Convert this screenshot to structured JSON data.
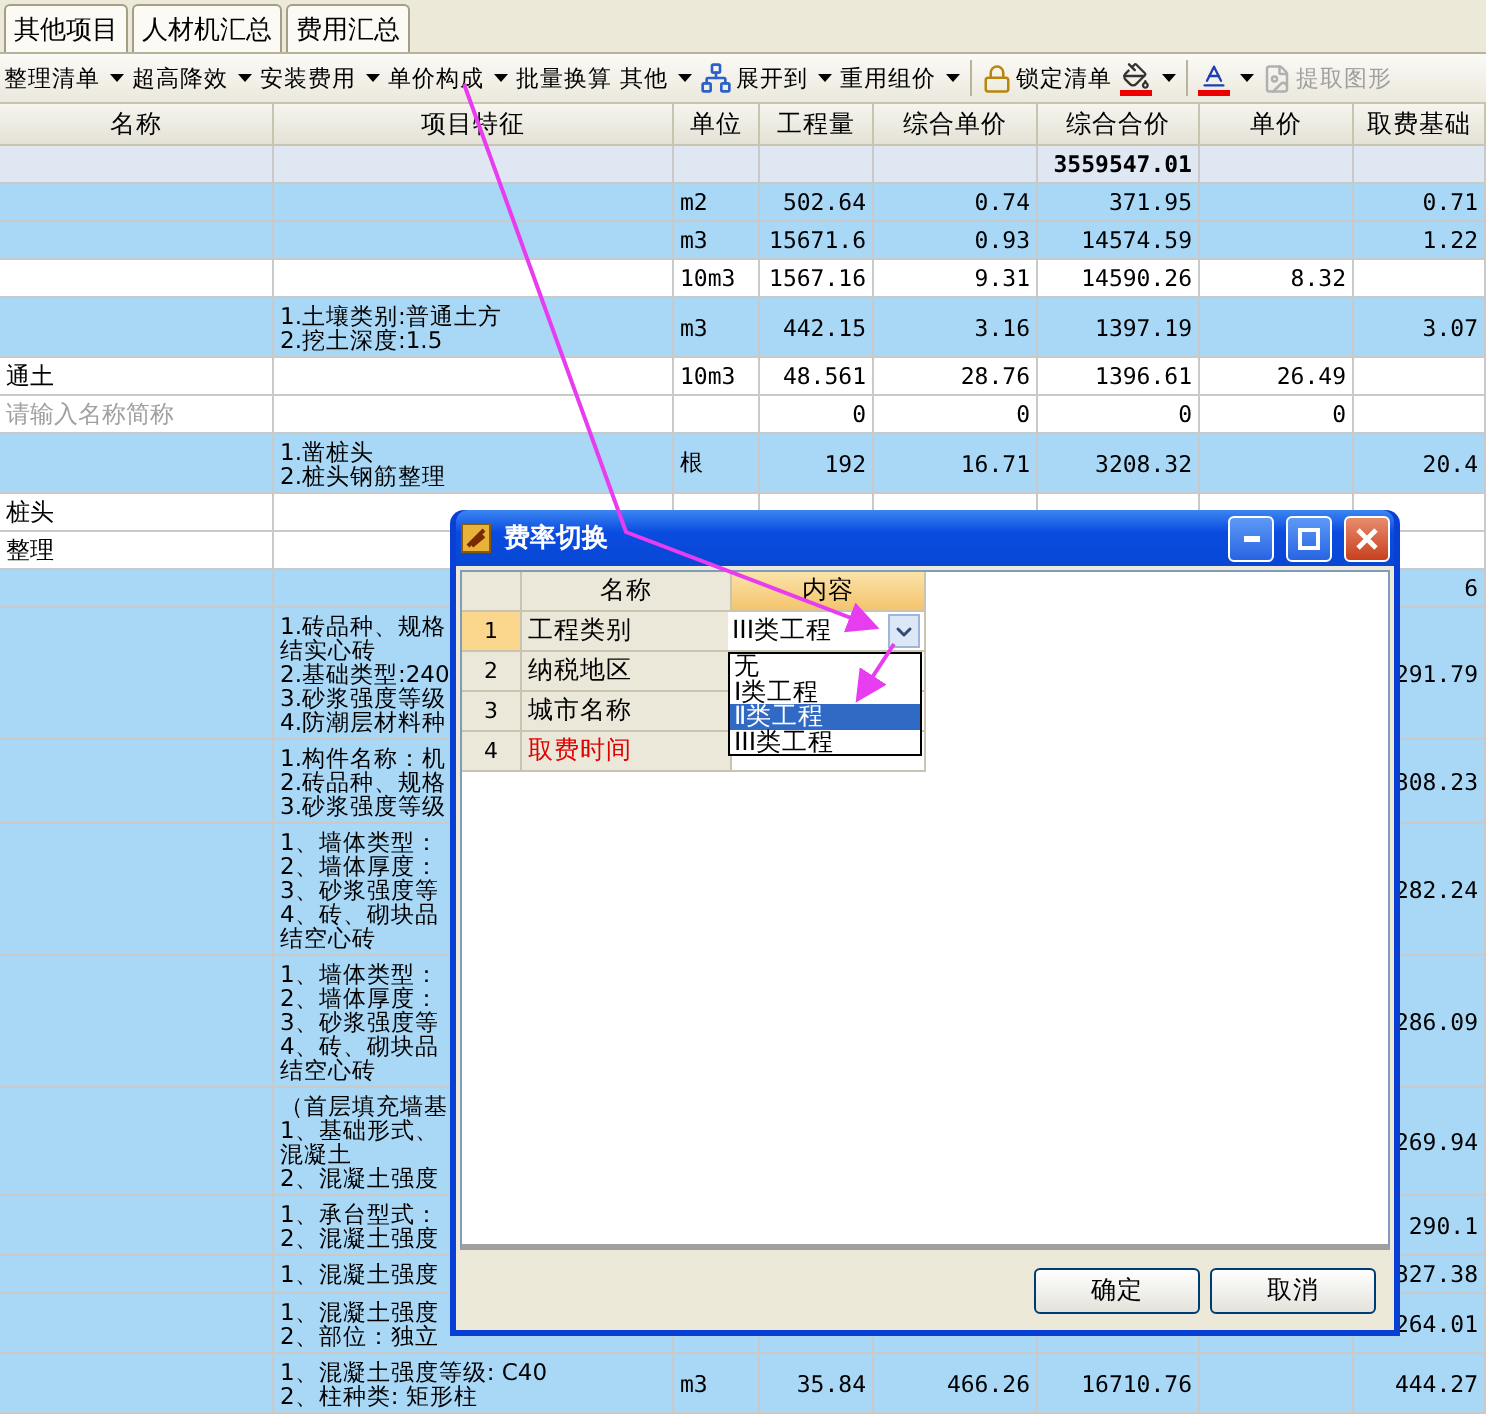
{
  "tabs": [
    {
      "label": "其他项目"
    },
    {
      "label": "人材机汇总"
    },
    {
      "label": "费用汇总"
    }
  ],
  "toolbar": [
    {
      "kind": "menu",
      "label": "整理清单",
      "disabled": false
    },
    {
      "kind": "menu",
      "label": "超高降效",
      "disabled": false
    },
    {
      "kind": "menu",
      "label": "安装费用",
      "disabled": false
    },
    {
      "kind": "menu",
      "label": "单价构成",
      "disabled": false
    },
    {
      "kind": "button",
      "label": "批量换算",
      "disabled": false
    },
    {
      "kind": "menu",
      "label": "其他",
      "disabled": false
    },
    {
      "kind": "tree",
      "label": "展开到",
      "disabled": false
    },
    {
      "kind": "menu",
      "label": "重用组价",
      "disabled": false
    },
    {
      "kind": "separator"
    },
    {
      "kind": "lock",
      "label": "锁定清单",
      "disabled": false
    },
    {
      "kind": "fill",
      "disabled": false
    },
    {
      "kind": "separator"
    },
    {
      "kind": "font",
      "disabled": false
    },
    {
      "kind": "extract",
      "label": "提取图形",
      "disabled": true
    }
  ],
  "table": {
    "columns": [
      "名称",
      "项目特征",
      "单位",
      "工程量",
      "综合单价",
      "综合合价",
      "单价",
      "取费基础"
    ],
    "rows": [
      {
        "kind": "total",
        "total": "3559547.01"
      },
      {
        "kind": "bill",
        "unit": "m2",
        "qty": "502.64",
        "unit_price": "0.74",
        "total": "371.95",
        "fee_base": "0.71"
      },
      {
        "kind": "bill",
        "unit": "m3",
        "qty": "15671.6",
        "unit_price": "0.93",
        "total": "14574.59",
        "fee_base": "1.22"
      },
      {
        "kind": "quota",
        "unit": "10m3",
        "qty": "1567.16",
        "unit_price": "9.31",
        "total": "14590.26",
        "price": "8.32"
      },
      {
        "kind": "bill",
        "feature": [
          "1.土壤类别:普通土方",
          "2.挖土深度:1.5"
        ],
        "unit": "m3",
        "qty": "442.15",
        "unit_price": "3.16",
        "total": "1397.19",
        "fee_base": "3.07"
      },
      {
        "kind": "quota",
        "name": "通土",
        "unit": "10m3",
        "qty": "48.561",
        "unit_price": "28.76",
        "total": "1396.61",
        "price": "26.49"
      },
      {
        "kind": "quota",
        "placeholder": "请输入名称简称",
        "qty": "0",
        "unit_price": "0",
        "total": "0",
        "price": "0"
      },
      {
        "kind": "bill",
        "feature": [
          "1.凿桩头",
          "2.桩头钢筋整理"
        ],
        "unit": "根",
        "qty": "192",
        "unit_price": "16.71",
        "total": "3208.32",
        "fee_base": "20.4"
      },
      {
        "kind": "quota",
        "name": "桩头"
      },
      {
        "kind": "quota",
        "name": "整理"
      },
      {
        "kind": "bill",
        "fee_base": "6"
      },
      {
        "kind": "bill",
        "feature": [
          "1.砖品种、规格",
          "结实心砖",
          "2.基础类型:240",
          "3.砂浆强度等级",
          "4.防潮层材料种"
        ],
        "fee_base": "291.79"
      },
      {
        "kind": "bill",
        "feature": [
          "1.构件名称：机",
          "2.砖品种、规格",
          "3.砂浆强度等级"
        ],
        "fee_base": "308.23"
      },
      {
        "kind": "bill",
        "feature": [
          "1、墙体类型：",
          "2、墙体厚度：",
          "3、砂浆强度等",
          "4、砖、砌块品",
          "结空心砖"
        ],
        "fee_base": "282.24"
      },
      {
        "kind": "bill",
        "feature": [
          "1、墙体类型：",
          "2、墙体厚度：",
          "3、砂浆强度等",
          "4、砖、砌块品",
          "结空心砖"
        ],
        "fee_base": "286.09"
      },
      {
        "kind": "bill",
        "feature": [
          "（首层填充墙基",
          "1、基础形式、",
          "混凝土",
          "2、混凝土强度"
        ],
        "fee_base": "269.94"
      },
      {
        "kind": "bill",
        "feature": [
          "1、承台型式：",
          "2、混凝土强度"
        ],
        "fee_base": "290.1"
      },
      {
        "kind": "bill",
        "feature": [
          "1、混凝土强度"
        ],
        "fee_base": "327.38"
      },
      {
        "kind": "bill",
        "feature": [
          "1、混凝土强度",
          "2、部位：独立"
        ],
        "fee_base": "264.01"
      },
      {
        "kind": "bill",
        "feature": [
          "1、混凝土强度等级: C40",
          "2、柱种类: 矩形柱"
        ],
        "unit": "m3",
        "qty": "35.84",
        "unit_price": "466.26",
        "total": "16710.76",
        "fee_base": "444.27"
      }
    ]
  },
  "dialog": {
    "title": "费率切换",
    "columns": [
      {
        "label": "名称",
        "selected": false
      },
      {
        "label": "内容",
        "selected": true
      }
    ],
    "rows": [
      {
        "no": "1",
        "name": "工程类别",
        "color": "#000000",
        "selected": true,
        "value": "III类工程"
      },
      {
        "no": "2",
        "name": "纳税地区",
        "color": "#000000",
        "selected": false
      },
      {
        "no": "3",
        "name": "城市名称",
        "color": "#000000",
        "selected": false
      },
      {
        "no": "4",
        "name": "取费时间",
        "color": "#e00000",
        "selected": false
      }
    ],
    "dropdown": {
      "expanded": true,
      "options": [
        {
          "label": "无",
          "selected": false
        },
        {
          "label": "Ⅰ类工程",
          "selected": false
        },
        {
          "label": "Ⅱ类工程",
          "selected": true
        },
        {
          "label": "III类工程",
          "selected": false
        }
      ]
    },
    "buttons": [
      "确定",
      "取消"
    ]
  }
}
